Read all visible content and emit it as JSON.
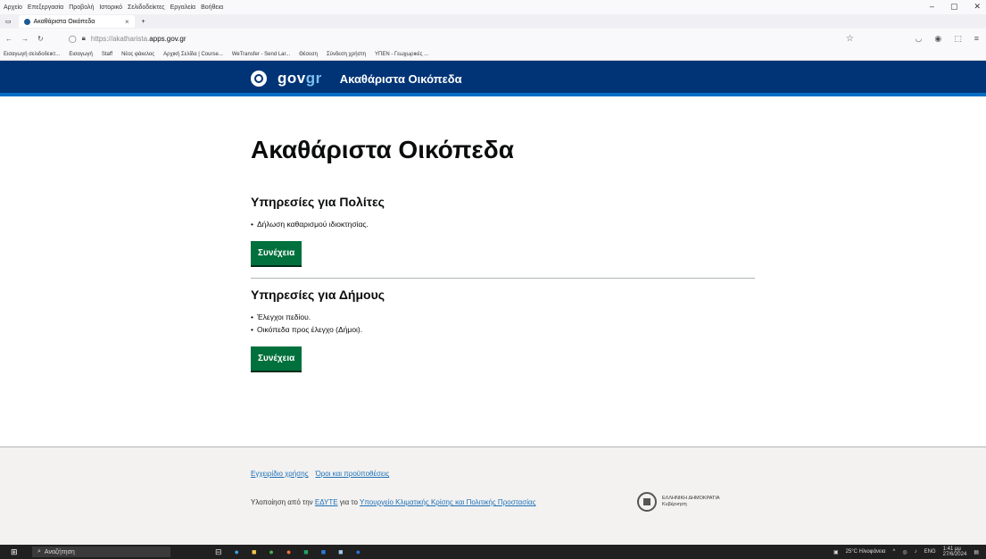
{
  "browser": {
    "menu": [
      "Αρχείο",
      "Επεξεργασία",
      "Προβολή",
      "Ιστορικό",
      "Σελιδοδείκτες",
      "Εργαλεία",
      "Βοήθεια"
    ],
    "tab_title": "Ακαθάριστα Οικόπεδα",
    "url_prefix": "https://akatharista.",
    "url_domain": "apps.gov.gr",
    "bookmarks": [
      "Εισαγωγή σελιδοδεικτ...",
      "Εισαγωγή",
      "Staff",
      "Νέος φάκελος",
      "Αρχική Σελίδα | Course...",
      "WeTransfer - Send Lar...",
      "Θέσεση",
      "Σύνδεση χρήστη",
      "ΥΠΕΝ - Γεωχωρικές ..."
    ]
  },
  "header": {
    "gov": "gov",
    "gr": "gr",
    "service_name": "Ακαθάριστα Οικόπεδα"
  },
  "main": {
    "title": "Ακαθάριστα Οικόπεδα",
    "citizens": {
      "heading": "Υπηρεσίες για Πολίτες",
      "items": [
        "Δήλωση καθαρισμού ιδιοκτησίας."
      ],
      "button": "Συνέχεια"
    },
    "municipalities": {
      "heading": "Υπηρεσίες για Δήμους",
      "items": [
        "Έλεγχοι πεδίου.",
        "Οικόπεδα προς έλεγχο (Δήμοι)."
      ],
      "button": "Συνέχεια"
    }
  },
  "footer": {
    "link_manual": "Εγχειρίδιο χρήσης",
    "link_terms": "Όροι και προϋποθέσεις",
    "credit_prefix": "Υλοποίηση από την",
    "credit_org": "ΕΔΥΤΕ",
    "credit_mid": "για το",
    "credit_ministry": "Υπουργείο Κλιματικής Κρίσης και Πολιτικής Προστασίας",
    "emblem_line1": "ΕΛΛΗΝΙΚΗ ΔΗΜΟΚΡΑΤΙΑ",
    "emblem_line2": "Κυβέρνηση"
  },
  "taskbar": {
    "search_placeholder": "Αναζήτηση",
    "weather": "25°C Ηλιοφάνεια",
    "lang": "ENG",
    "time": "1:41 μμ",
    "date": "27/6/2024"
  },
  "colors": {
    "header_bg": "#003476",
    "button_bg": "#00703c",
    "link": "#1d70b8"
  }
}
